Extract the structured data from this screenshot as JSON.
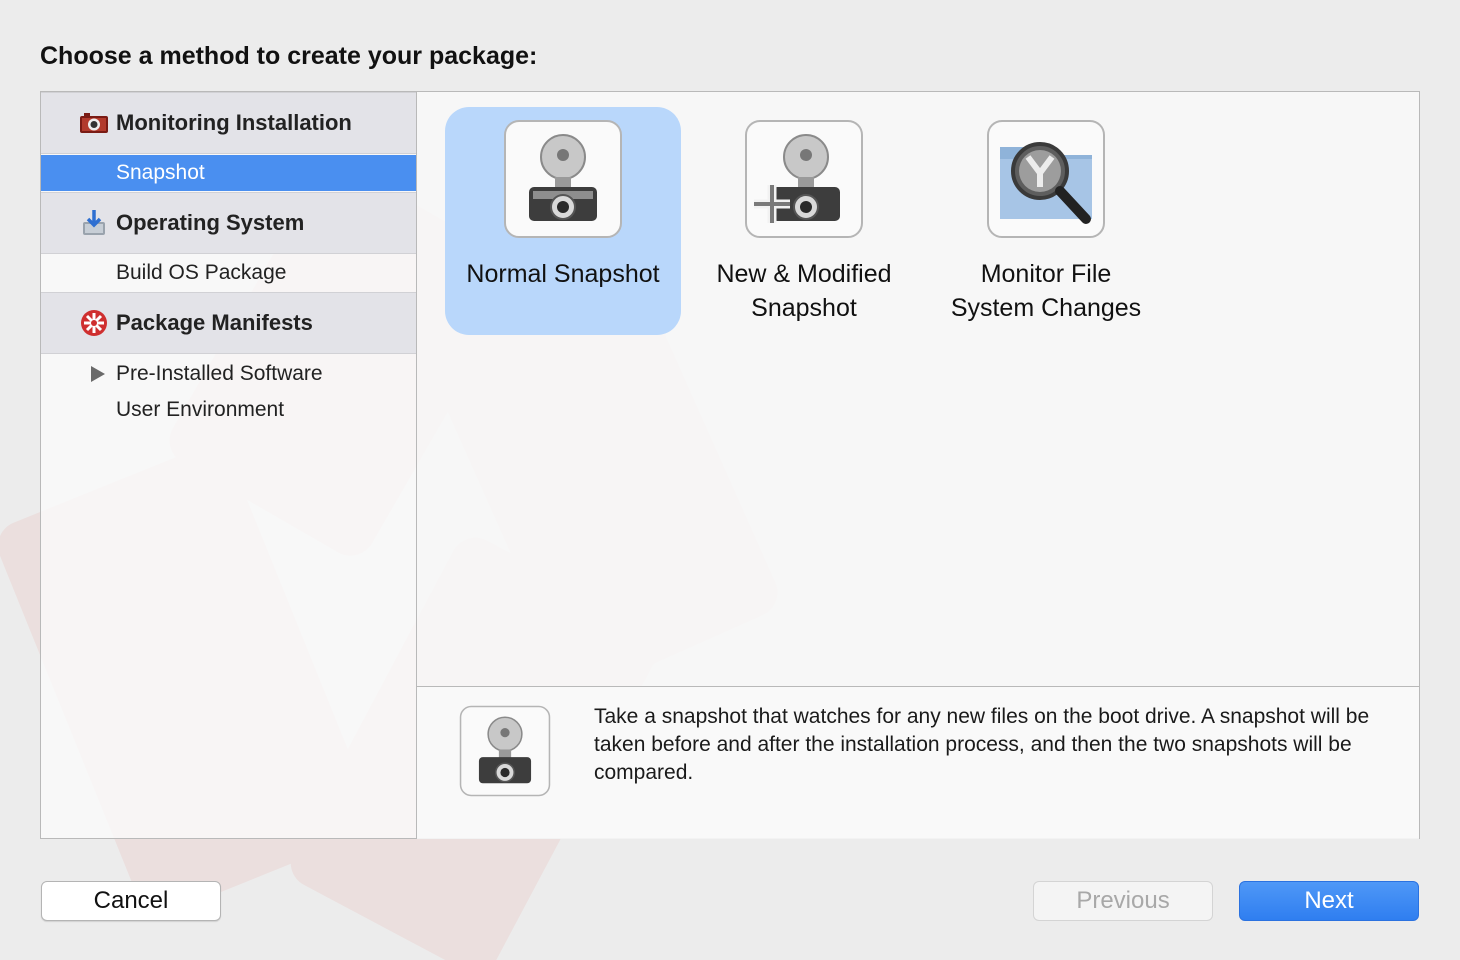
{
  "dialog": {
    "title": "Choose a method to create your package:"
  },
  "sidebar": {
    "sections": [
      {
        "label": "Monitoring Installation",
        "icon": "camera-icon",
        "items": [
          {
            "label": "Snapshot",
            "selected": true
          }
        ]
      },
      {
        "label": "Operating System",
        "icon": "os-installer-icon",
        "items": [
          {
            "label": "Build OS Package",
            "selected": false
          }
        ]
      },
      {
        "label": "Package Manifests",
        "icon": "package-manifests-icon",
        "items": [
          {
            "label": "Pre-Installed Software",
            "selected": false,
            "expandable": true
          },
          {
            "label": "User Environment",
            "selected": false
          }
        ]
      }
    ]
  },
  "options": [
    {
      "label": "Normal Snapshot",
      "icon": "flash-camera-icon",
      "selected": true
    },
    {
      "label": "New  &  Modified\nSnapshot",
      "icon": "flash-camera-plus-icon",
      "selected": false
    },
    {
      "label": "Monitor File\nSystem Changes",
      "icon": "magnifier-folder-icon",
      "selected": false
    }
  ],
  "description": {
    "icon": "flash-camera-icon",
    "text": "Take a snapshot that watches for any new files on the boot drive. A snapshot will be taken before and after the installation process, and then the two snapshots will be compared."
  },
  "buttons": {
    "cancel": "Cancel",
    "previous": "Previous",
    "next": "Next",
    "previous_enabled": false
  },
  "colors": {
    "selection_blue": "#4a8ff0",
    "option_highlight": "#b9d7fb",
    "accent_red": "#c0392b"
  }
}
